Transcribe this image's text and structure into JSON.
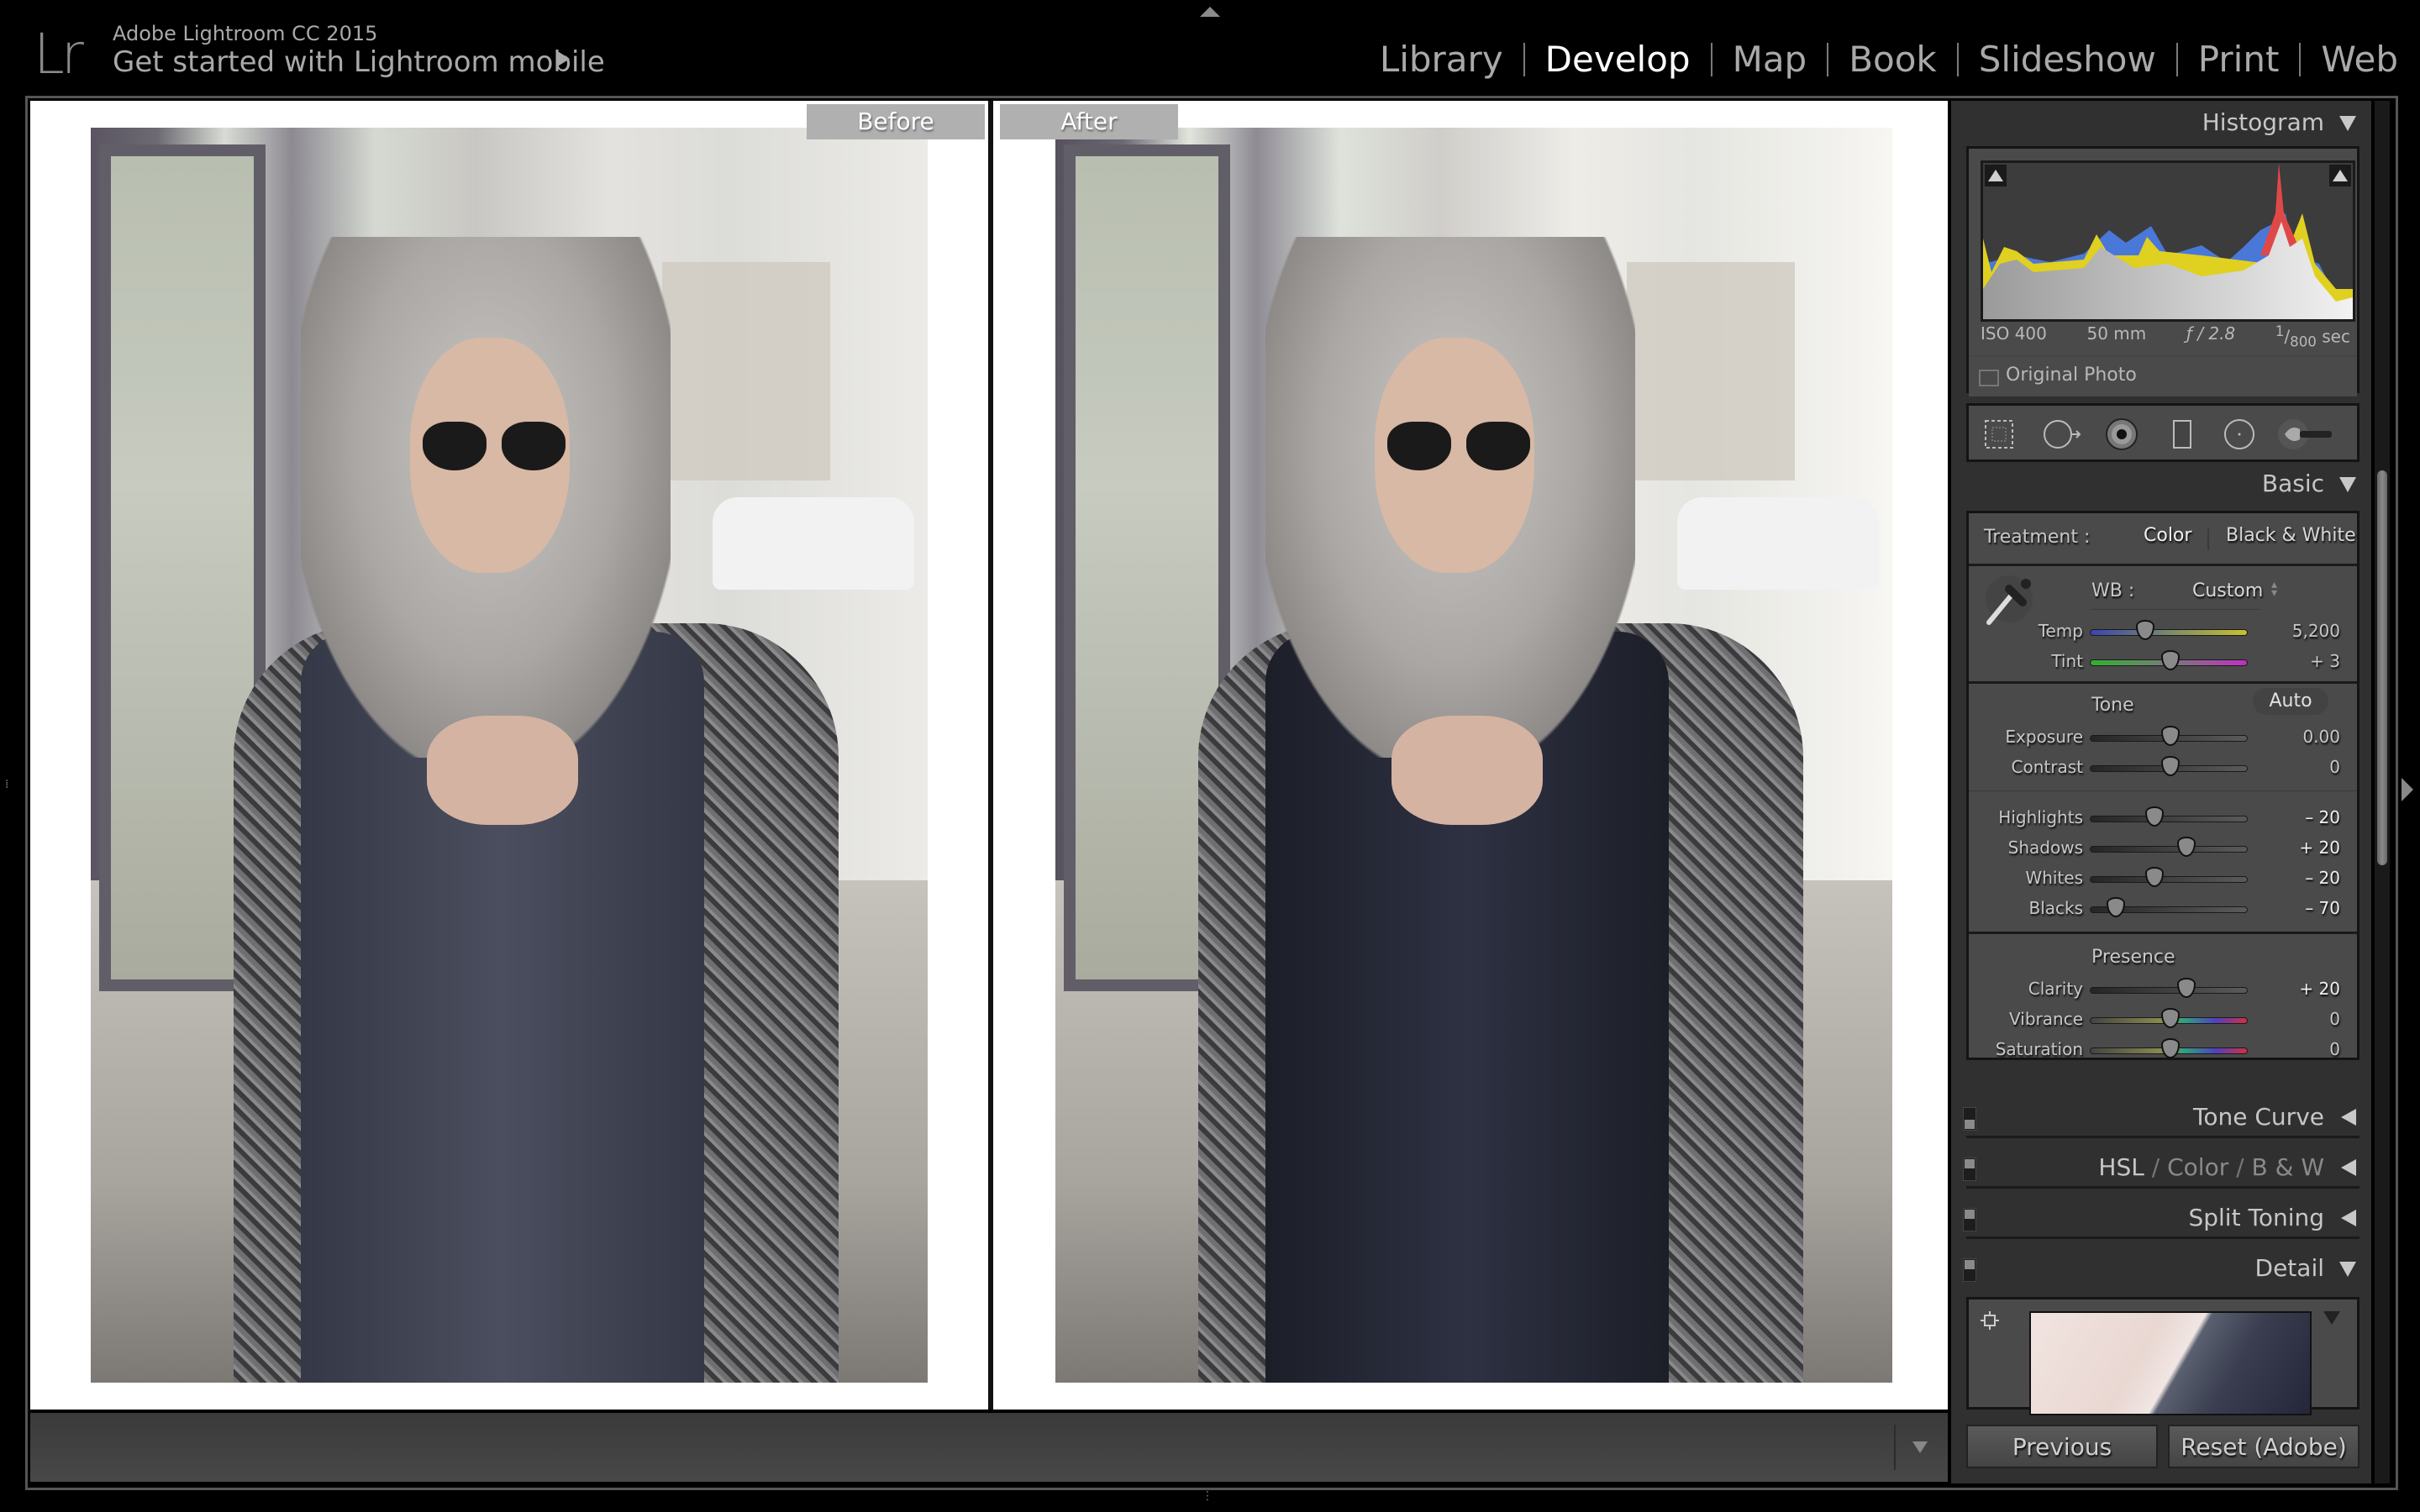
{
  "header": {
    "logo": "Lr",
    "app_title": "Adobe Lightroom CC 2015",
    "mobile_link": "Get started with Lightroom mobile",
    "modules": [
      {
        "label": "Library",
        "active": false
      },
      {
        "label": "Develop",
        "active": true
      },
      {
        "label": "Map",
        "active": false
      },
      {
        "label": "Book",
        "active": false
      },
      {
        "label": "Slideshow",
        "active": false
      },
      {
        "label": "Print",
        "active": false
      },
      {
        "label": "Web",
        "active": false
      }
    ]
  },
  "viewer": {
    "before_label": "Before",
    "after_label": "After"
  },
  "panel": {
    "histogram": {
      "title": "Histogram",
      "exif": {
        "iso": "ISO 400",
        "focal_length": "50 mm",
        "aperture": "ƒ / 2.8",
        "shutter_num": "1",
        "shutter_den": "800",
        "shutter_unit": "sec"
      },
      "original_photo_label": "Original Photo",
      "original_photo_checked": false
    },
    "tools": [
      "crop-overlay-icon",
      "spot-removal-icon",
      "red-eye-icon",
      "graduated-filter-icon",
      "radial-filter-icon",
      "adjustment-brush-icon"
    ],
    "basic": {
      "title": "Basic",
      "treatment_label": "Treatment :",
      "treatment_options": [
        "Color",
        "Black & White"
      ],
      "treatment_selected": "Color",
      "wb_label": "WB :",
      "wb_value": "Custom",
      "tone_label": "Tone",
      "auto_label": "Auto",
      "presence_label": "Presence",
      "sliders": {
        "temp": {
          "label": "Temp",
          "value": "5,200",
          "position": 0.34
        },
        "tint": {
          "label": "Tint",
          "value": "+ 3",
          "position": 0.5
        },
        "exposure": {
          "label": "Exposure",
          "value": "0.00",
          "position": 0.5
        },
        "contrast": {
          "label": "Contrast",
          "value": "0",
          "position": 0.5
        },
        "highlights": {
          "label": "Highlights",
          "value": "– 20",
          "position": 0.4
        },
        "shadows": {
          "label": "Shadows",
          "value": "+ 20",
          "position": 0.6
        },
        "whites": {
          "label": "Whites",
          "value": "– 20",
          "position": 0.4
        },
        "blacks": {
          "label": "Blacks",
          "value": "– 70",
          "position": 0.15
        },
        "clarity": {
          "label": "Clarity",
          "value": "+ 20",
          "position": 0.6
        },
        "vibrance": {
          "label": "Vibrance",
          "value": "0",
          "position": 0.5
        },
        "saturation": {
          "label": "Saturation",
          "value": "0",
          "position": 0.5
        }
      }
    },
    "collapsed_sections": {
      "tone_curve": "Tone Curve",
      "hsl": "HSL",
      "color": "Color",
      "bw": "B & W",
      "split_toning": "Split Toning"
    },
    "detail": {
      "title": "Detail"
    },
    "buttons": {
      "previous": "Previous",
      "reset": "Reset (Adobe)"
    }
  }
}
